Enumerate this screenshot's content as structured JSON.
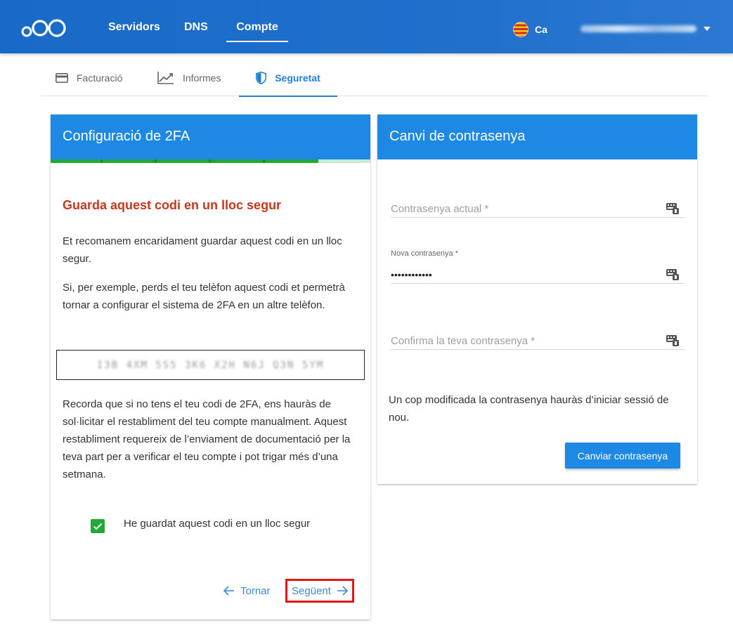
{
  "header": {
    "nav": [
      {
        "label": "Servidors"
      },
      {
        "label": "DNS"
      },
      {
        "label": "Compte"
      }
    ],
    "language": "Ca",
    "accent_color": "#1e6dca"
  },
  "subtabs": [
    {
      "label": "Facturació",
      "icon": "credit-card-icon"
    },
    {
      "label": "Informes",
      "icon": "trending-chart-icon"
    },
    {
      "label": "Seguretat",
      "icon": "shield-icon"
    }
  ],
  "twofa": {
    "title": "Configuració de 2FA",
    "progress_completed_steps": 5,
    "progress_total_steps": 6,
    "warning_title": "Guarda aquest codi en un lloc segur",
    "paragraph1": "Et recomanem encaridament guardar aquest codi en un lloc segur.",
    "paragraph2": "Si, per exemple, perds el teu telèfon aquest codi et permetrà tornar a configurar el sistema de 2FA en un altre telèfon.",
    "paragraph3": "Recorda que si no tens el teu codi de 2FA, ens hauràs de sol·licitar el restabliment del teu compte manualment. Aquest restabliment requereix de l’enviament de documentació per la teva part per a verificar el teu compte i pot trigar més d’una setmana.",
    "checkbox_label": "He guardat aquest codi en un lloc segur",
    "checkbox_checked": true,
    "back_label": "Tornar",
    "next_label": "Següent",
    "success_color": "#20a935",
    "warning_color": "#c8371b"
  },
  "password": {
    "title": "Canvi de contrasenya",
    "current_placeholder": "Contrasenya actual *",
    "new_label": "Nova contrasenya *",
    "new_value": "••••••••••••",
    "confirm_placeholder": "Confirma la teva contrasenya *",
    "note": "Un cop modificada la contrasenya hauràs d’iniciar sessió de nou.",
    "button_label": "Canviar contrasenya"
  }
}
